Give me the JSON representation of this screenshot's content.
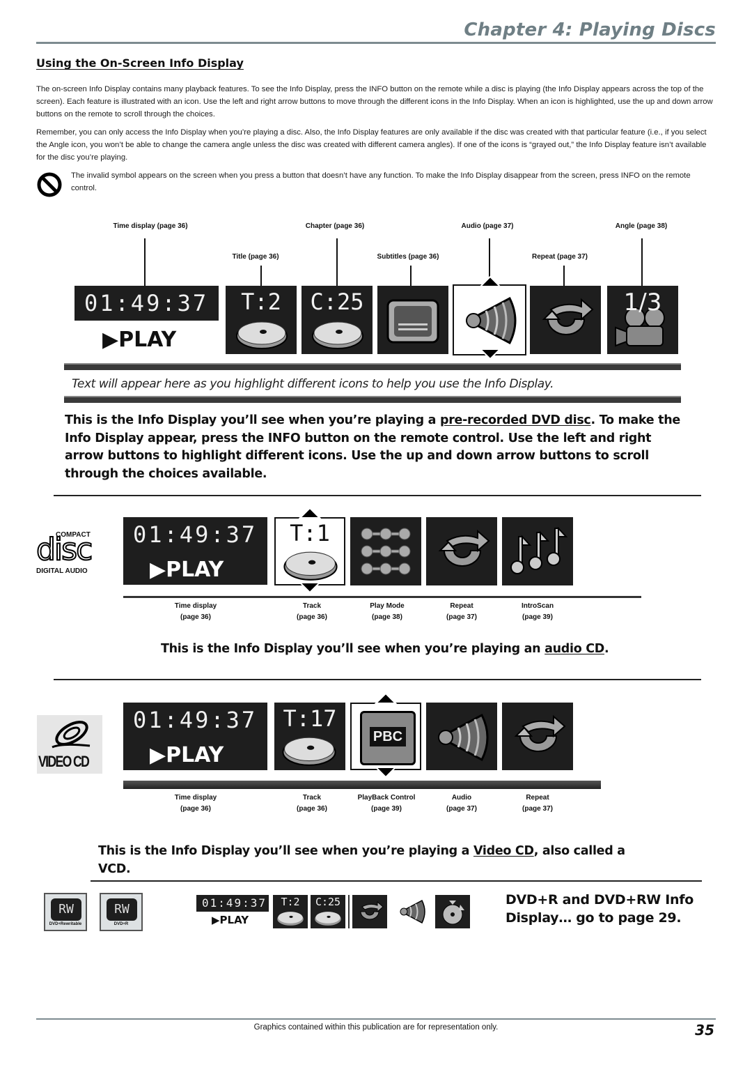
{
  "header": {
    "chapter_title": "Chapter 4: Playing Discs"
  },
  "section": {
    "heading": "Using the On-Screen Info Display",
    "paragraphs": [
      "The on-screen Info Display contains many playback features. To see the Info Display, press the INFO button on the remote while a disc is playing (the Info Display appears across the top of the screen). Each feature is illustrated with an icon. Use the left and right arrow buttons to move through the different icons in the Info Display. When an icon is highlighted, use the up and down arrow buttons on the remote to scroll through the choices.",
      "Remember, you can only access the Info Display when you’re playing a disc. Also, the Info Display features are only available if the disc was created with that particular feature (i.e., if you select the Angle icon, you won’t be able to change the camera angle unless the disc was created with different camera angles). If one of the icons is “grayed out,” the Info Display feature isn’t available for the disc you’re playing."
    ],
    "invalid_note": "The invalid symbol appears on the screen when you press a button that doesn’t have any function. To make the Info Display disappear from the screen, press INFO on the remote control.",
    "invalid_icon": "prohibited-icon"
  },
  "dvd_display": {
    "callouts_top": [
      "Time display (page 36)",
      "Chapter (page 36)",
      "Audio (page 37)",
      "Angle (page 38)"
    ],
    "callouts_bottom": [
      "Title (page 36)",
      "Subtitles (page 36)",
      "Repeat (page 37)"
    ],
    "time": "01:49:37",
    "play_label": "PLAY",
    "title_value": "T:2",
    "chapter_value": "C:25",
    "angle_value": "1/3",
    "icons": [
      "disc-icon",
      "disc-icon",
      "subtitle-icon",
      "audio-speaker-icon",
      "repeat-icon",
      "camera-angle-icon"
    ],
    "highlighted": "Audio",
    "help_text": "Text will appear here as you highlight different icons to help you use the Info Display.",
    "description_pre": "This is the Info Display you’ll see when you’re playing a ",
    "description_link": "pre-recorded DVD disc",
    "description_post": ". To make the Info Display appear, press the INFO button on the remote control. Use the left and right arrow buttons to highlight different icons. Use the up and down arrow buttons to scroll through the choices available."
  },
  "cd_display": {
    "logo_top": "COMPACT",
    "logo_main": "disc",
    "logo_bottom": "DIGITAL AUDIO",
    "time": "01:49:37",
    "play_label": "PLAY",
    "track_value": "T:1",
    "highlighted": "Track",
    "captions": [
      {
        "label": "Time display",
        "page": "(page 36)"
      },
      {
        "label": "Track",
        "page": "(page 36)"
      },
      {
        "label": "Play Mode",
        "page": "(page 38)"
      },
      {
        "label": "Repeat",
        "page": "(page 37)"
      },
      {
        "label": "IntroScan",
        "page": "(page 39)"
      }
    ],
    "description_pre": "This is the Info Display you’ll see when you’re playing an ",
    "description_link": "audio CD",
    "description_post": "."
  },
  "vcd_display": {
    "logo_text": "VIDEO CD",
    "time": "01:49:37",
    "play_label": "PLAY",
    "track_value": "T:17",
    "pbc_label": "PBC",
    "highlighted": "PlayBack Control",
    "captions": [
      {
        "label": "Time display",
        "page": "(page 36)"
      },
      {
        "label": "Track",
        "page": "(page 36)"
      },
      {
        "label": "PlayBack Control",
        "page": "(page 39)"
      },
      {
        "label": "Audio",
        "page": "(page 37)"
      },
      {
        "label": "Repeat",
        "page": "(page 37)"
      }
    ],
    "description_pre": "This is the Info Display you’ll see when you’re playing a ",
    "description_link": "Video CD",
    "description_post": ", also called a VCD."
  },
  "dvd_plus": {
    "badge_rw_label": "RW",
    "badge_rw_caption": "DVD+Rewritable",
    "badge_r_label": "RW",
    "badge_r_caption": "DVD+R",
    "time": "01:49:37",
    "play_label": "PLAY",
    "title_value": "T:2",
    "chapter_value": "C:25",
    "note": "DVD+R and DVD+RW Info Display… go to page 29."
  },
  "footer": {
    "note": "Graphics contained within this publication are for representation only.",
    "page_number": "35"
  }
}
